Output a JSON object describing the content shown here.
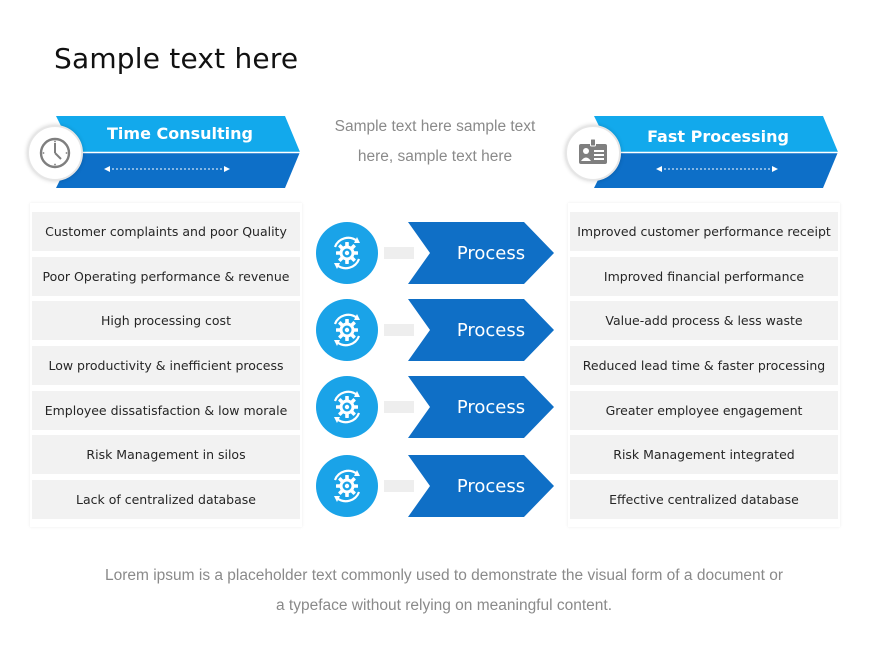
{
  "title": "Sample text here",
  "center_text": "Sample text here sample text here, sample text here",
  "footer_text": "Lorem ipsum is a placeholder text commonly used to demonstrate the visual form of a document or a typeface without relying on meaningful content.",
  "colors": {
    "light_blue": "#12a9ec",
    "dark_blue": "#0d6fc8",
    "process_blue": "#0f6fc6",
    "gear_blue": "#1aa3e8",
    "row_bg": "#f2f2f2",
    "icon_gray": "#7f7f7f"
  },
  "left": {
    "header": "Time Consulting",
    "icon": "clock-icon",
    "items": [
      "Customer complaints and poor Quality",
      "Poor Operating performance & revenue",
      "High processing cost",
      "Low productivity & inefficient process",
      "Employee dissatisfaction & low morale",
      "Risk Management in silos",
      "Lack of centralized database"
    ]
  },
  "right": {
    "header": "Fast Processing",
    "icon": "id-card-icon",
    "items": [
      "Improved customer performance receipt",
      "Improved financial performance",
      "Value-add process & less waste",
      "Reduced lead time & faster processing",
      "Greater employee engagement",
      "Risk Management integrated",
      "Effective centralized database"
    ]
  },
  "process": {
    "icon": "gear-cycle-icon",
    "steps": [
      "Process",
      "Process",
      "Process",
      "Process"
    ]
  }
}
